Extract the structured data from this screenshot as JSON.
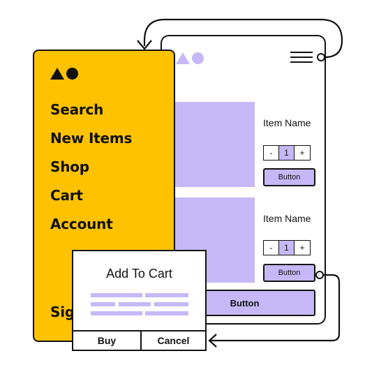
{
  "menu": {
    "items": [
      "Search",
      "New Items",
      "Shop",
      "Cart",
      "Account"
    ],
    "cutoff_item": "Sig"
  },
  "phone": {
    "products": [
      {
        "name": "Item Name",
        "minus": "-",
        "qty": "1",
        "plus": "+",
        "button_label": "Button"
      },
      {
        "name": "Item Name",
        "minus": "-",
        "qty": "1",
        "plus": "+",
        "button_label": "Button"
      }
    ],
    "bottom_button_label": "Button"
  },
  "popup": {
    "title": "Add To Cart",
    "buy_label": "Buy",
    "cancel_label": "Cancel"
  },
  "colors": {
    "yellow": "#FFC200",
    "lavender": "#C6B8F7",
    "ink": "#111111"
  },
  "icons": [
    "triangle-icon",
    "circle-icon",
    "hamburger-menu-icon",
    "arrow-icon"
  ]
}
